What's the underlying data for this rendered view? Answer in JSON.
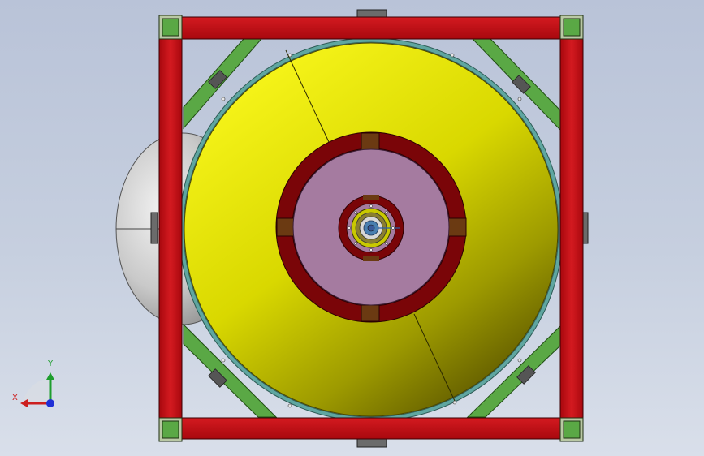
{
  "triad": {
    "x_label": "X",
    "y_label": "Y",
    "colors": {
      "x": "#cc1f1f",
      "y": "#1e9e2e",
      "z": "#1f2fd6"
    }
  },
  "colors": {
    "background_top": "#b9c3d8",
    "background_bottom": "#d9dfea",
    "frame_red": "#c8161c",
    "brace_green": "#5aa845",
    "rim_teal": "#5fa6a0",
    "cone_yellow": "#e6e400",
    "hub_maroon": "#7a0508",
    "hub_pink": "#a57ba0",
    "drum_gray": "#bfbfbf"
  }
}
